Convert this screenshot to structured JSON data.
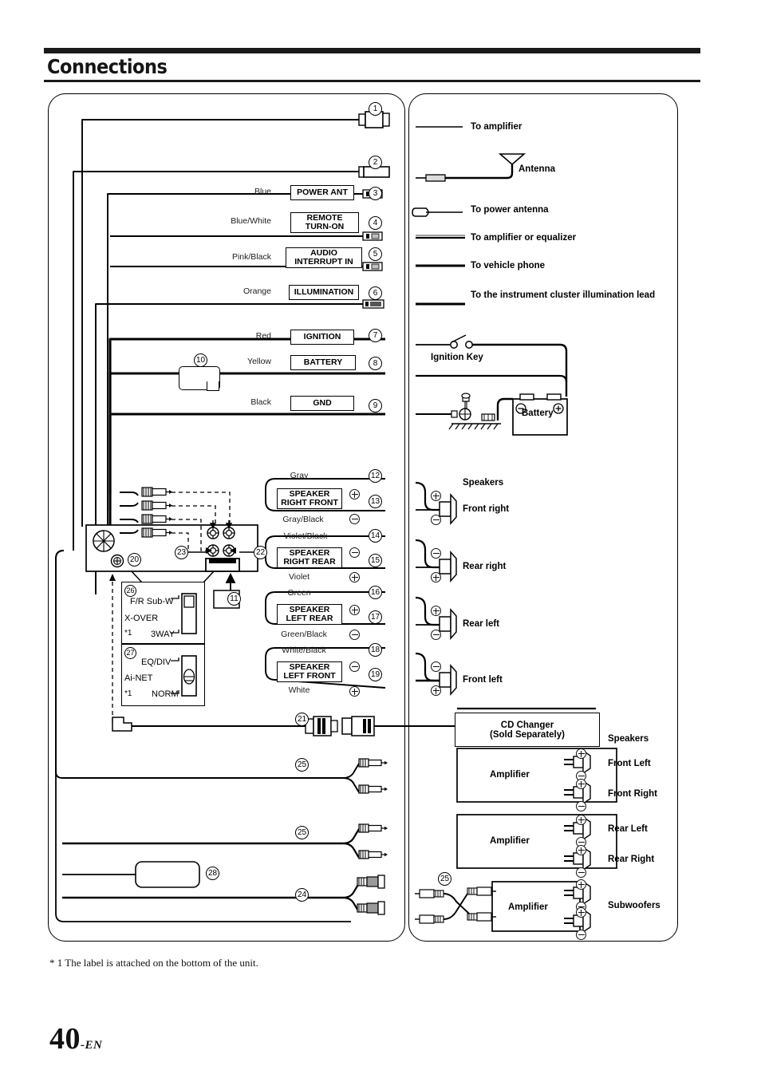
{
  "header": {
    "title": "Connections"
  },
  "footnote": "* 1 The label is attached on the bottom of the unit.",
  "page": {
    "number": "40",
    "suffix": "-EN"
  },
  "left_panel": {
    "wires": [
      {
        "callout": "1",
        "color": "",
        "label": ""
      },
      {
        "callout": "2",
        "color": "",
        "label": ""
      },
      {
        "callout": "3",
        "color": "Blue",
        "label": "POWER ANT"
      },
      {
        "callout": "4",
        "color": "Blue/White",
        "label": "REMOTE TURN-ON"
      },
      {
        "callout": "5",
        "color": "Pink/Black",
        "label": "AUDIO INTERRUPT IN"
      },
      {
        "callout": "6",
        "color": "Orange",
        "label": "ILLUMINATION"
      },
      {
        "callout": "7",
        "color": "Red",
        "label": "IGNITION"
      },
      {
        "callout": "8",
        "color": "Yellow",
        "label": "BATTERY"
      },
      {
        "callout": "9",
        "color": "Black",
        "label": "GND"
      }
    ],
    "fuse_callout": "10",
    "speaker_wires": [
      {
        "callout": "12",
        "color": "Gray",
        "label": "",
        "polarity": ""
      },
      {
        "callout": "13",
        "color": "",
        "label": "SPEAKER RIGHT FRONT",
        "polarity": "plus"
      },
      {
        "callout": "",
        "color": "Gray/Black",
        "label": "",
        "polarity": "minus"
      },
      {
        "callout": "14",
        "color": "Violet/Black",
        "label": "",
        "polarity": ""
      },
      {
        "callout": "15",
        "color": "",
        "label": "SPEAKER RIGHT REAR",
        "polarity": "minus"
      },
      {
        "callout": "",
        "color": "Violet",
        "label": "",
        "polarity": "plus"
      },
      {
        "callout": "16",
        "color": "Green",
        "label": "",
        "polarity": ""
      },
      {
        "callout": "17",
        "color": "",
        "label": "SPEAKER LEFT REAR",
        "polarity": "plus"
      },
      {
        "callout": "",
        "color": "Green/Black",
        "label": "",
        "polarity": "minus"
      },
      {
        "callout": "18",
        "color": "White/Black",
        "label": "",
        "polarity": ""
      },
      {
        "callout": "19",
        "color": "",
        "label": "SPEAKER LEFT FRONT",
        "polarity": "minus"
      },
      {
        "callout": "",
        "color": "White",
        "label": "",
        "polarity": "plus"
      }
    ],
    "unit_callouts": [
      "20",
      "22",
      "23",
      "11"
    ],
    "switch_xover": {
      "callout": "26",
      "top_label": "F/R Sub-W",
      "name": "X-OVER",
      "bottom_label": "3WAY",
      "note": "1",
      "note_mark": "*"
    },
    "switch_ainet": {
      "callout": "27",
      "top_label": "EQ/DIV",
      "name": "Ai-NET",
      "bottom_label": "NORM",
      "note": "1",
      "note_mark": "*"
    },
    "cable_callouts": {
      "cd_changer": "21",
      "rca_a": "25",
      "rca_b": "25",
      "rca_c": "24",
      "box_28": "28"
    }
  },
  "right_panel": {
    "legend": [
      {
        "text": "To amplifier"
      },
      {
        "text": "Antenna"
      },
      {
        "text": "To power antenna"
      },
      {
        "text": "To amplifier or equalizer"
      },
      {
        "text": "To vehicle phone"
      },
      {
        "text": "To the instrument cluster illumination lead"
      }
    ],
    "ignition_key": "Ignition Key",
    "battery": "Battery",
    "speakers_title": "Speakers",
    "speakers": [
      {
        "name": "Front right",
        "top": "plus",
        "bottom": "minus"
      },
      {
        "name": "Rear right",
        "top": "minus",
        "bottom": "plus"
      },
      {
        "name": "Rear left",
        "top": "plus",
        "bottom": "minus"
      },
      {
        "name": "Front left",
        "top": "minus",
        "bottom": "plus"
      }
    ],
    "cd_changer": {
      "line1": "CD Changer",
      "line2": "(Sold Separately)"
    },
    "amp_section_title": "Speakers",
    "amplifiers": [
      {
        "label": "Amplifier",
        "outputs": [
          "Front Left",
          "Front Right"
        ]
      },
      {
        "label": "Amplifier",
        "outputs": [
          "Rear Left",
          "Rear Right"
        ]
      },
      {
        "label": "Amplifier",
        "outputs": [
          "Subwoofers"
        ],
        "rca_callout": "25"
      }
    ]
  },
  "colors": {
    "ink": "#000000",
    "rule": "#1a1a1a",
    "paper": "#ffffff"
  }
}
